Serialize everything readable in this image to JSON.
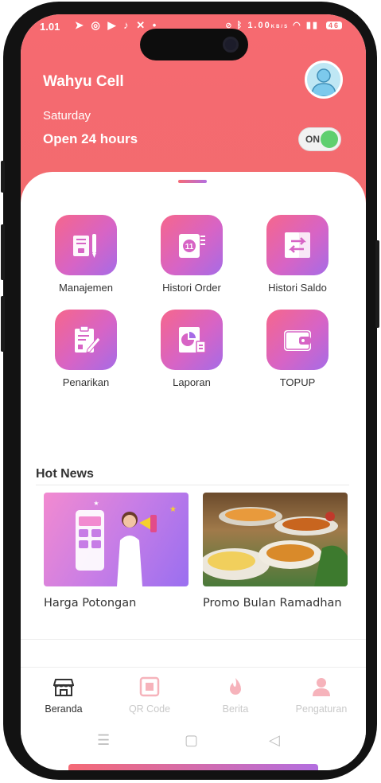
{
  "status_bar": {
    "time": "1.01",
    "left_icons": [
      "telegram-icon",
      "whatsapp-icon",
      "youtube-icon",
      "tiktok-icon",
      "x-icon"
    ],
    "speed": "1.00",
    "speed_unit": "KB/S",
    "battery": "46"
  },
  "header": {
    "store_name": "Wahyu Cell",
    "day": "Saturday",
    "hours": "Open 24 hours",
    "toggle_label": "ON"
  },
  "menu": [
    {
      "label": "Manajemen",
      "icon": "document-pen-icon"
    },
    {
      "label": "Histori Order",
      "icon": "order-history-icon"
    },
    {
      "label": "Histori Saldo",
      "icon": "transfer-arrows-icon"
    },
    {
      "label": "Penarikan",
      "icon": "clipboard-edit-icon"
    },
    {
      "label": "Laporan",
      "icon": "report-chart-icon"
    },
    {
      "label": "TOPUP",
      "icon": "wallet-icon"
    }
  ],
  "news": {
    "title": "Hot News",
    "items": [
      {
        "caption": "Harga Potongan",
        "image": "promo-woman-megaphone-image"
      },
      {
        "caption": "Promo Bulan Ramadhan",
        "image": "ramadhan-food-image"
      }
    ]
  },
  "bottom_nav": [
    {
      "label": "Beranda",
      "icon": "store-icon",
      "active": true
    },
    {
      "label": "QR Code",
      "icon": "qr-code-icon",
      "active": false
    },
    {
      "label": "Berita",
      "icon": "flame-icon",
      "active": false
    },
    {
      "label": "Pengaturan",
      "icon": "user-icon",
      "active": false
    }
  ],
  "colors": {
    "header": "#f26b6f",
    "tile_start": "#f6668c",
    "tile_end": "#a66be6",
    "toggle_on": "#5fcf6f"
  }
}
